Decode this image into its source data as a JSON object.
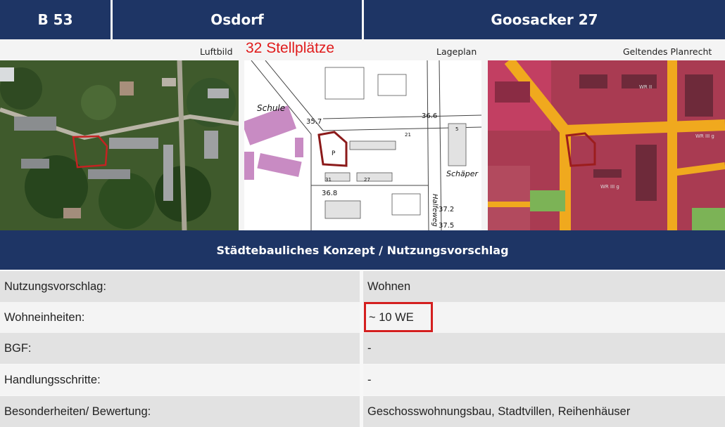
{
  "header": {
    "code": "B 53",
    "district": "Osdorf",
    "address": "Goosacker 27"
  },
  "images": {
    "aerial_caption": "Luftbild",
    "parking_note": "32 Stellplätze",
    "site_plan_caption": "Lageplan",
    "zoning_caption": "Geltendes Planrecht",
    "site_plan_labels": {
      "school": "Schule",
      "parking": "P",
      "street1": "Halfeweg",
      "street2": "Schäper",
      "elev1": "35.7",
      "elev2": "36.6",
      "elev3": "36.8",
      "elev4": "37.2",
      "elev5": "37.5",
      "plot1": "31",
      "plot2": "27",
      "plot3": "21",
      "plot4": "5"
    },
    "zoning_labels": {
      "wr1": "WR II",
      "wr2": "WR III g",
      "wr3": "WR III g"
    }
  },
  "section_title": "Städtebauliches Konzept / Nutzungsvorschlag",
  "rows": [
    {
      "label": "Nutzungsvorschlag:",
      "value": "Wohnen"
    },
    {
      "label": "Wohneinheiten:",
      "value": "~ 10 WE"
    },
    {
      "label": "BGF:",
      "value": "-"
    },
    {
      "label": "Handlungsschritte:",
      "value": "-"
    },
    {
      "label": "Besonderheiten/ Bewertung:",
      "value": "Geschosswohnungsbau, Stadtvillen, Reihenhäuser"
    }
  ],
  "colors": {
    "header_blue": "#1e3565",
    "highlight_red": "#d41f1f"
  }
}
